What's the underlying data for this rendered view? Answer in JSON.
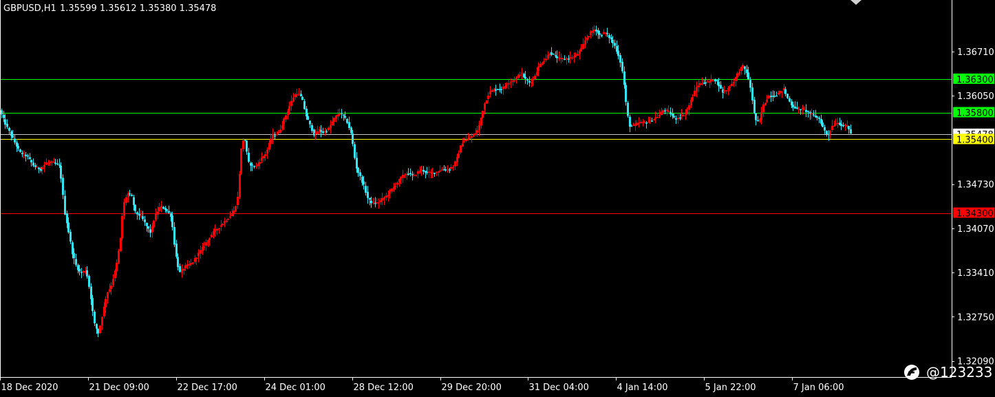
{
  "header": {
    "symbol_label": "GBPUSD,H1",
    "ohlc_text": "1.35599 1.35612 1.35380 1.35478"
  },
  "watermark": {
    "text": "@123233",
    "logo_icon": "weibo-icon"
  },
  "colors": {
    "background": "#000000",
    "bull": "#ff0000",
    "bear": "#33e6f5",
    "axis": "#ffffff",
    "level_green": "#00ff00",
    "level_red": "#ff0000",
    "level_yellow": "#ffff00",
    "tag_bid": "#ffffff"
  },
  "chart_data": {
    "type": "candlestick",
    "symbol": "GBPUSD",
    "timeframe": "H1",
    "ohlc": {
      "open": 1.35599,
      "high": 1.35612,
      "low": 1.3538,
      "close": 1.35478
    },
    "ylim": [
      1.3185,
      1.3748
    ],
    "y_ticks": [
      "1.36710",
      "1.36050",
      "1.35478",
      "1.34730",
      "1.34070",
      "1.33410",
      "1.32750",
      "1.32090"
    ],
    "x_ticks": [
      "18 Dec 2020",
      "21 Dec 09:00",
      "22 Dec 17:00",
      "24 Dec 01:00",
      "28 Dec 12:00",
      "29 Dec 20:00",
      "31 Dec 04:00",
      "4 Jan 14:00",
      "5 Jan 22:00",
      "7 Jan 06:00"
    ],
    "levels": [
      {
        "price": 1.363,
        "label": "1.36300",
        "color": "#00ff00"
      },
      {
        "price": 1.358,
        "label": "1.35800",
        "color": "#00ff00"
      },
      {
        "price": 1.354,
        "label": "1.35400",
        "color": "#ffff00"
      },
      {
        "price": 1.343,
        "label": "1.34300",
        "color": "#ff0000"
      }
    ],
    "bid_label": "1.35478",
    "bid_price": 1.35478,
    "path_points": [
      [
        0,
        1.3585
      ],
      [
        10,
        1.356
      ],
      [
        20,
        1.354
      ],
      [
        30,
        1.352
      ],
      [
        40,
        1.3515
      ],
      [
        50,
        1.35
      ],
      [
        60,
        1.3495
      ],
      [
        68,
        1.3505
      ],
      [
        80,
        1.3505
      ],
      [
        88,
        1.35
      ],
      [
        95,
        1.343
      ],
      [
        100,
        1.3405
      ],
      [
        106,
        1.337
      ],
      [
        112,
        1.335
      ],
      [
        118,
        1.334
      ],
      [
        126,
        1.3345
      ],
      [
        132,
        1.331
      ],
      [
        138,
        1.3265
      ],
      [
        144,
        1.325
      ],
      [
        150,
        1.328
      ],
      [
        156,
        1.331
      ],
      [
        162,
        1.332
      ],
      [
        170,
        1.335
      ],
      [
        176,
        1.339
      ],
      [
        180,
        1.344
      ],
      [
        186,
        1.346
      ],
      [
        192,
        1.3455
      ],
      [
        198,
        1.343
      ],
      [
        206,
        1.3425
      ],
      [
        214,
        1.341
      ],
      [
        220,
        1.34
      ],
      [
        226,
        1.3425
      ],
      [
        234,
        1.344
      ],
      [
        242,
        1.3435
      ],
      [
        250,
        1.3425
      ],
      [
        256,
        1.337
      ],
      [
        262,
        1.334
      ],
      [
        270,
        1.335
      ],
      [
        280,
        1.3355
      ],
      [
        290,
        1.337
      ],
      [
        300,
        1.3385
      ],
      [
        310,
        1.34
      ],
      [
        320,
        1.341
      ],
      [
        330,
        1.342
      ],
      [
        340,
        1.343
      ],
      [
        346,
        1.345
      ],
      [
        352,
        1.353
      ],
      [
        356,
        1.3545
      ],
      [
        362,
        1.3505
      ],
      [
        368,
        1.35
      ],
      [
        374,
        1.35
      ],
      [
        380,
        1.351
      ],
      [
        388,
        1.352
      ],
      [
        396,
        1.3545
      ],
      [
        406,
        1.355
      ],
      [
        414,
        1.357
      ],
      [
        422,
        1.359
      ],
      [
        428,
        1.3605
      ],
      [
        434,
        1.361
      ],
      [
        440,
        1.36
      ],
      [
        446,
        1.3575
      ],
      [
        452,
        1.356
      ],
      [
        458,
        1.3545
      ],
      [
        464,
        1.3555
      ],
      [
        470,
        1.355
      ],
      [
        478,
        1.3555
      ],
      [
        486,
        1.357
      ],
      [
        494,
        1.358
      ],
      [
        500,
        1.3575
      ],
      [
        506,
        1.3565
      ],
      [
        512,
        1.3545
      ],
      [
        518,
        1.35
      ],
      [
        524,
        1.3485
      ],
      [
        530,
        1.347
      ],
      [
        536,
        1.345
      ],
      [
        542,
        1.3445
      ],
      [
        550,
        1.3445
      ],
      [
        556,
        1.345
      ],
      [
        562,
        1.3455
      ],
      [
        570,
        1.3465
      ],
      [
        578,
        1.3475
      ],
      [
        586,
        1.3485
      ],
      [
        594,
        1.349
      ],
      [
        602,
        1.3485
      ],
      [
        612,
        1.3495
      ],
      [
        622,
        1.349
      ],
      [
        632,
        1.349
      ],
      [
        642,
        1.3495
      ],
      [
        652,
        1.3495
      ],
      [
        660,
        1.35
      ],
      [
        666,
        1.3515
      ],
      [
        672,
        1.3535
      ],
      [
        680,
        1.354
      ],
      [
        688,
        1.3545
      ],
      [
        696,
        1.3555
      ],
      [
        704,
        1.359
      ],
      [
        712,
        1.361
      ],
      [
        720,
        1.3615
      ],
      [
        730,
        1.3615
      ],
      [
        740,
        1.3625
      ],
      [
        750,
        1.363
      ],
      [
        758,
        1.364
      ],
      [
        764,
        1.363
      ],
      [
        770,
        1.3625
      ],
      [
        776,
        1.363
      ],
      [
        782,
        1.3645
      ],
      [
        788,
        1.3655
      ],
      [
        794,
        1.366
      ],
      [
        800,
        1.367
      ],
      [
        806,
        1.3665
      ],
      [
        814,
        1.366
      ],
      [
        822,
        1.366
      ],
      [
        830,
        1.3662
      ],
      [
        838,
        1.3665
      ],
      [
        846,
        1.3675
      ],
      [
        852,
        1.369
      ],
      [
        860,
        1.37
      ],
      [
        866,
        1.3705
      ],
      [
        872,
        1.3695
      ],
      [
        880,
        1.37
      ],
      [
        888,
        1.369
      ],
      [
        894,
        1.368
      ],
      [
        900,
        1.3665
      ],
      [
        904,
        1.365
      ],
      [
        908,
        1.362
      ],
      [
        912,
        1.358
      ],
      [
        916,
        1.356
      ],
      [
        922,
        1.356
      ],
      [
        930,
        1.3565
      ],
      [
        940,
        1.3565
      ],
      [
        950,
        1.357
      ],
      [
        958,
        1.3575
      ],
      [
        966,
        1.3585
      ],
      [
        974,
        1.358
      ],
      [
        982,
        1.357
      ],
      [
        990,
        1.3575
      ],
      [
        998,
        1.358
      ],
      [
        1006,
        1.36
      ],
      [
        1014,
        1.362
      ],
      [
        1022,
        1.3625
      ],
      [
        1030,
        1.3625
      ],
      [
        1038,
        1.363
      ],
      [
        1044,
        1.3625
      ],
      [
        1050,
        1.361
      ],
      [
        1058,
        1.3615
      ],
      [
        1066,
        1.3625
      ],
      [
        1074,
        1.364
      ],
      [
        1080,
        1.365
      ],
      [
        1086,
        1.364
      ],
      [
        1092,
        1.3615
      ],
      [
        1098,
        1.357
      ],
      [
        1104,
        1.3565
      ],
      [
        1110,
        1.359
      ],
      [
        1118,
        1.3605
      ],
      [
        1126,
        1.3605
      ],
      [
        1134,
        1.361
      ],
      [
        1140,
        1.3615
      ],
      [
        1146,
        1.36
      ],
      [
        1152,
        1.359
      ],
      [
        1160,
        1.3585
      ],
      [
        1168,
        1.3585
      ],
      [
        1176,
        1.358
      ],
      [
        1184,
        1.3575
      ],
      [
        1192,
        1.357
      ],
      [
        1198,
        1.3555
      ],
      [
        1204,
        1.3545
      ],
      [
        1210,
        1.356
      ],
      [
        1218,
        1.3565
      ],
      [
        1226,
        1.356
      ],
      [
        1232,
        1.356
      ],
      [
        1238,
        1.3548
      ]
    ]
  }
}
